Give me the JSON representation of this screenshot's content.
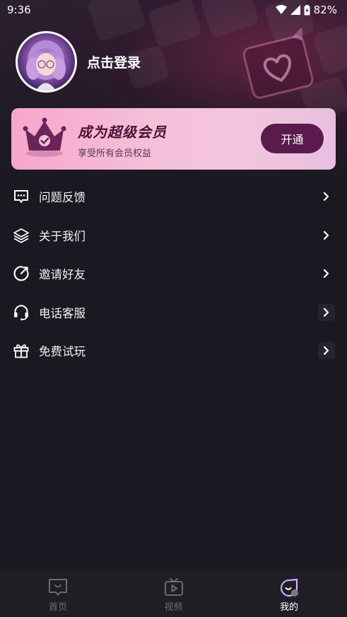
{
  "status": {
    "time": "9:36",
    "battery": "82%"
  },
  "profile": {
    "login_text": "点击登录"
  },
  "vip": {
    "title": "成为超级会员",
    "subtitle": "享受所有会员权益",
    "button": "开通"
  },
  "menu": [
    {
      "label": "问题反馈",
      "icon": "feedback-chat-icon"
    },
    {
      "label": "关于我们",
      "icon": "layers-icon"
    },
    {
      "label": "邀请好友",
      "icon": "share-refresh-icon"
    },
    {
      "label": "电话客服",
      "icon": "headset-icon"
    },
    {
      "label": "免费试玩",
      "icon": "gift-icon"
    }
  ],
  "tabs": [
    {
      "label": "首页",
      "icon": "home-tv-icon",
      "active": false
    },
    {
      "label": "视频",
      "icon": "video-play-icon",
      "active": false
    },
    {
      "label": "我的",
      "icon": "profile-icon",
      "active": true
    }
  ],
  "colors": {
    "background": "#1a1921",
    "vip_button": "#5b1a4e",
    "vip_title": "#4a1037",
    "tab_inactive": "#6c6b73"
  }
}
